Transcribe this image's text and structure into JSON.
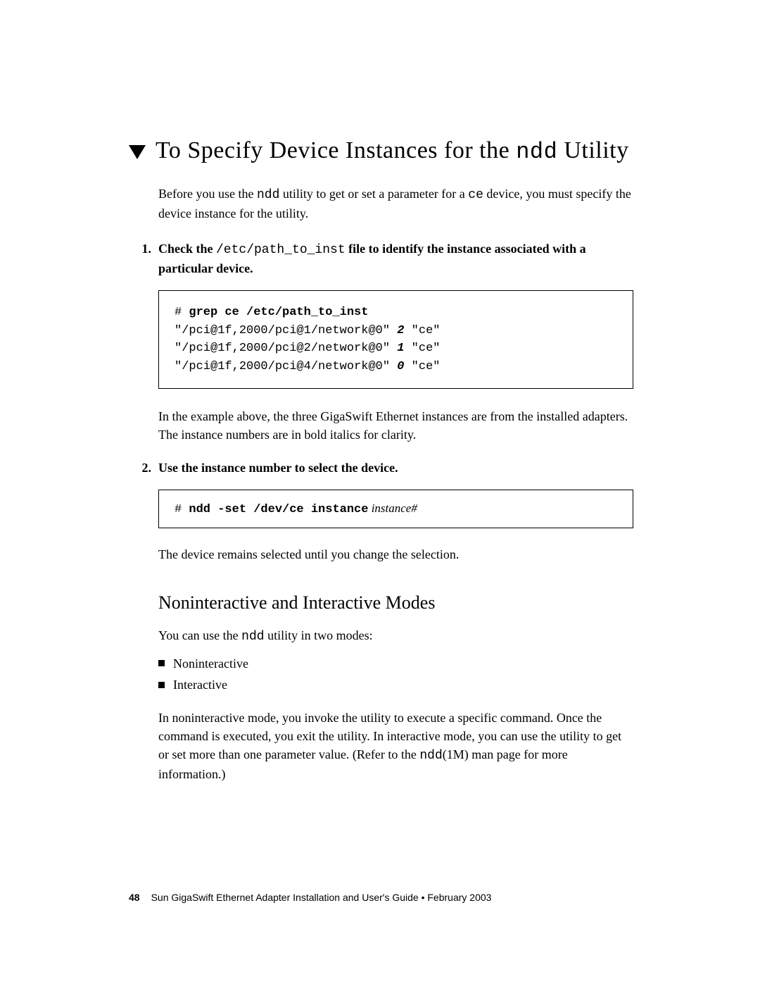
{
  "heading": {
    "pre": "To Specify Device Instances for the ",
    "code": "ndd",
    "post": " Utility"
  },
  "intro": {
    "t1": "Before you use the ",
    "c1": "ndd",
    "t2": " utility to get or set a parameter for a ",
    "c2": "ce",
    "t3": " device, you must specify the device instance for the utility."
  },
  "step1": {
    "num": "1.",
    "t1": "Check the ",
    "c1": "/etc/path_to_inst",
    "t2": " file to identify the instance associated with a particular device."
  },
  "code1": {
    "l0a": "# ",
    "l0b": "grep ce /etc/path_to_inst",
    "l1a": "\"/pci@1f,2000/pci@1/network@0\" ",
    "l1b": "2",
    "l1c": " \"ce\"",
    "l2a": "\"/pci@1f,2000/pci@2/network@0\" ",
    "l2b": "1",
    "l2c": " \"ce\"",
    "l3a": "\"/pci@1f,2000/pci@4/network@0\" ",
    "l3b": "0",
    "l3c": " \"ce\""
  },
  "para_after_code1": "In the example above, the three GigaSwift Ethernet instances are from the installed adapters. The instance numbers are in bold italics for clarity.",
  "step2": {
    "num": "2.",
    "text": "Use the instance number to select the device."
  },
  "code2": {
    "prefix": "# ",
    "bold": "ndd -set /dev/ce instance",
    "italic": " instance#"
  },
  "para_after_code2": "The device remains selected until you change the selection.",
  "subheading": "Noninteractive and Interactive Modes",
  "two_modes": {
    "t1": "You can use the ",
    "c1": "ndd",
    "t2": " utility in two modes:"
  },
  "bullets": {
    "b1": "Noninteractive",
    "b2": "Interactive"
  },
  "para_modes": {
    "t1": "In noninteractive mode, you invoke the utility to execute a specific command. Once the command is executed, you exit the utility. In interactive mode, you can use the utility to get or set more than one parameter value. (Refer to the ",
    "c1": "ndd",
    "t2": "(1M) man page for more information.)"
  },
  "footer": {
    "page": "48",
    "title": "Sun GigaSwift Ethernet Adapter Installation and User's Guide • February 2003"
  }
}
